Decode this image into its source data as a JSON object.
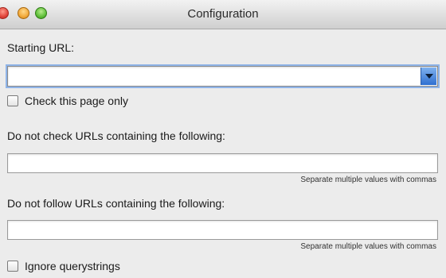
{
  "window": {
    "title": "Configuration"
  },
  "starting_url": {
    "label": "Starting URL:",
    "value": ""
  },
  "check_page_only": {
    "label": "Check this page only",
    "checked": false
  },
  "exclude_check": {
    "label": "Do not check URLs containing the following:",
    "value": "",
    "hint": "Separate multiple values with commas"
  },
  "exclude_follow": {
    "label": "Do not follow URLs containing the following:",
    "value": "",
    "hint": "Separate multiple values with commas"
  },
  "ignore_querystrings": {
    "label": "Ignore querystrings",
    "checked": false
  },
  "colors": {
    "focus_ring": "#8fb4e8",
    "combo_button": "#2f6fd0",
    "close": "#e0443a",
    "minimize": "#f2a93b",
    "zoom": "#5fbf3a"
  }
}
